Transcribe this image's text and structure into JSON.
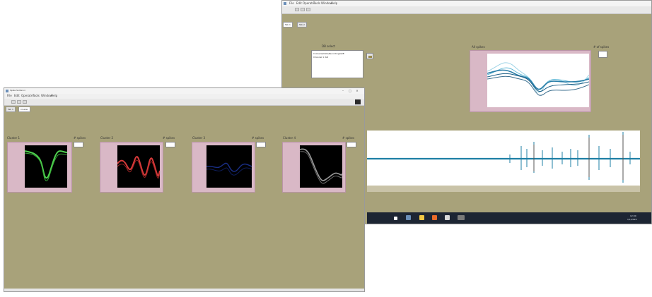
{
  "colors": {
    "panel_bg": "#a8a27a",
    "plot_frame": "#d9b8c6",
    "green_trace": "#4fd04f",
    "red_trace": "#d83a3a",
    "blue_trace": "#1f3aa8",
    "gray_trace": "#9a9a9a",
    "teal_trace": "#1e7fa5",
    "taskbar": "#1d2533"
  },
  "back_window": {
    "menu": [
      "File",
      "Edit",
      "Operate",
      "Tools",
      "Window",
      "Help"
    ],
    "tabs": [
      "Tab 1",
      "Tab 2"
    ],
    "list_label": "DB select",
    "list_lines": [
      "C:\\Users\\Data\\Recordings\\DB",
      "Channel 1 dat"
    ],
    "overlay_label": "All spikes",
    "overlay_counter_label": "# of spikes",
    "trace_icon": "waveform-trace"
  },
  "front_window": {
    "title": "Spike Sorter.vi",
    "menu": [
      "File",
      "Edit",
      "Operate",
      "Tools",
      "Window",
      "Help"
    ],
    "tabs": [
      "Tab 1",
      "Cluster"
    ],
    "channels": [
      {
        "label": "Cluster 1",
        "count_label": "# spikes"
      },
      {
        "label": "Cluster 2",
        "count_label": "# spikes"
      },
      {
        "label": "Cluster 3",
        "count_label": "# spikes"
      },
      {
        "label": "Cluster 4",
        "count_label": "# spikes"
      }
    ]
  },
  "taskbar": {
    "time": "12:00",
    "date": "1/1/2020"
  }
}
